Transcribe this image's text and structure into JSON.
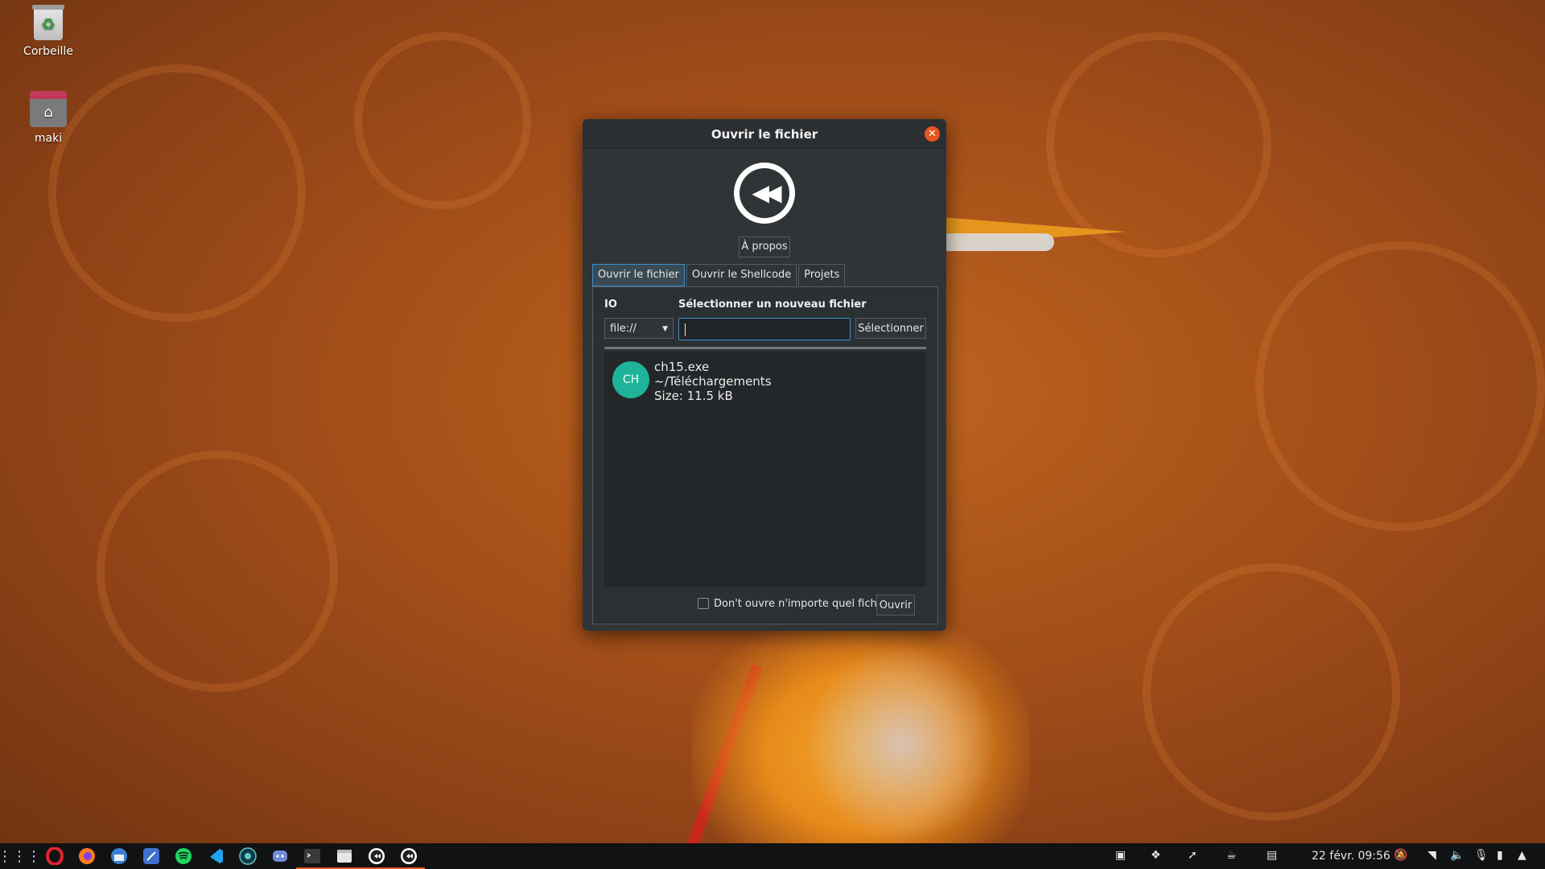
{
  "desktop": {
    "icons": [
      {
        "label": "Corbeille",
        "icon": "trash-icon"
      },
      {
        "label": "maki",
        "icon": "home-folder-icon"
      }
    ]
  },
  "dialog": {
    "title": "Ouvrir le fichier",
    "about_label": "À propos",
    "tabs": [
      {
        "label": "Ouvrir le fichier",
        "active": true
      },
      {
        "label": "Ouvrir le Shellcode",
        "active": false
      },
      {
        "label": "Projets",
        "active": false
      }
    ],
    "io_label": "IO",
    "io_value": "file://",
    "new_file_label": "Sélectionner un nouveau fichier",
    "path_input_value": "",
    "select_button_label": "Sélectionner",
    "recent_files": [
      {
        "avatar": "CH",
        "name": "ch15.exe",
        "path": "~/Téléchargements",
        "size": "Size: 11.5 kB"
      }
    ],
    "checkbox_label": "Don't ouvre n'importe quel fichier",
    "checkbox_checked": false,
    "open_button_label": "Ouvrir"
  },
  "taskbar": {
    "apps": [
      "app-grid-icon",
      "opera-icon",
      "firefox-icon",
      "thunderbird-icon",
      "kdevelop-icon",
      "spotify-icon",
      "vscode-icon",
      "tor-icon",
      "discord-icon",
      "terminal-icon",
      "files-icon",
      "cutter-icon",
      "cutter-icon"
    ],
    "clock": "22 févr.  09:56",
    "accent_color": "#e95420"
  }
}
